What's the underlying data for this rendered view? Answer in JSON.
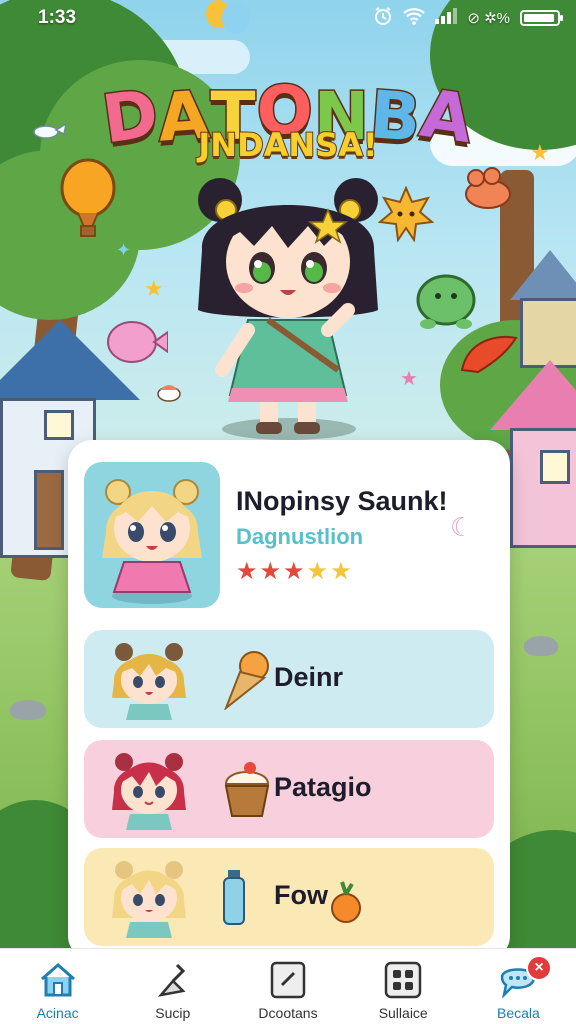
{
  "status_bar": {
    "time": "1:33",
    "alarm_icon": "alarm-icon",
    "wifi_icon": "wifi-icon",
    "signal_icon": "signal-icon",
    "extra_icons": "⊘ ✲%",
    "battery_icon": "battery-icon"
  },
  "title": {
    "main": "DATONBA",
    "letters": [
      "D",
      "A",
      "T",
      "O",
      "N",
      "B",
      "A"
    ],
    "letter_colors": [
      "#f26a8d",
      "#f5a623",
      "#f7d33b",
      "#ff5e5e",
      "#7cc84a",
      "#5fb6e8",
      "#c56ad8"
    ],
    "subtitle": "JNDANSA!"
  },
  "profile": {
    "name": "INopinsy Saunk!",
    "role": "Dagnustlion",
    "rating": 5,
    "rating_filled": 3,
    "star_colors": {
      "filled": "#e04a3a",
      "empty": "#f3c53a"
    },
    "side_icon": "moon-icon"
  },
  "items": [
    {
      "label": "Deinr",
      "bg": "#cdebf0",
      "icon": "ice-cream-cone-icon"
    },
    {
      "label": "Patagio",
      "bg": "#f8cfdc",
      "icon": "cupcake-icon"
    },
    {
      "label": "Fow",
      "bg": "#fbe9b5",
      "icon": "bottle-and-orange-icon"
    }
  ],
  "nav": [
    {
      "label": "Acinac",
      "icon": "home-icon",
      "active": true
    },
    {
      "label": "Sucip",
      "icon": "broom-icon",
      "active": false
    },
    {
      "label": "Dcootans",
      "icon": "document-icon",
      "active": false
    },
    {
      "label": "Sullaice",
      "icon": "grid-icon",
      "active": false
    },
    {
      "label": "Becala",
      "icon": "chat-icon",
      "active": false,
      "badge": "×"
    }
  ],
  "colors": {
    "accent": "#1c7fb0",
    "badge": "#e23b3b",
    "card": "#ffffff"
  }
}
